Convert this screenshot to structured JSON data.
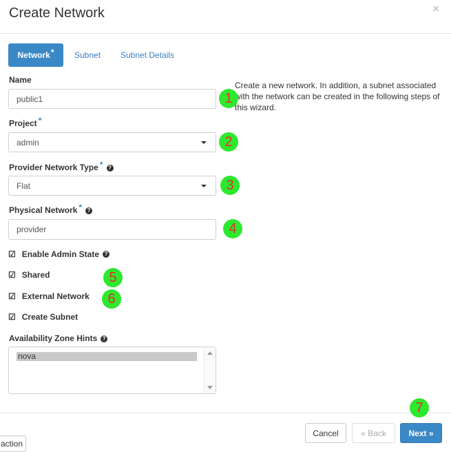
{
  "modal": {
    "title": "Create Network",
    "close_icon": "×"
  },
  "tabs": [
    {
      "label": "Network",
      "required_mark": "*",
      "active": true
    },
    {
      "label": "Subnet",
      "active": false
    },
    {
      "label": "Subnet Details",
      "active": false
    }
  ],
  "help_text": "Create a new network. In addition, a subnet associated with the network can be created in the following steps of this wizard.",
  "form": {
    "name": {
      "label": "Name",
      "value": "public1"
    },
    "project": {
      "label": "Project",
      "required_mark": "*",
      "value": "admin"
    },
    "provider_network_type": {
      "label": "Provider Network Type",
      "required_mark": "*",
      "help_icon": "?",
      "value": "Flat"
    },
    "physical_network": {
      "label": "Physical Network",
      "required_mark": "*",
      "help_icon": "?",
      "value": "provider"
    },
    "checkboxes": [
      {
        "label": "Enable Admin State",
        "checked": true,
        "help_icon": "?"
      },
      {
        "label": "Shared",
        "checked": true
      },
      {
        "label": "External Network",
        "checked": true
      },
      {
        "label": "Create Subnet",
        "checked": true
      }
    ],
    "availability_zone_hints": {
      "label": "Availability Zone Hints",
      "help_icon": "?",
      "options": [
        "nova"
      ]
    }
  },
  "annotations": [
    "1",
    "2",
    "3",
    "4",
    "5",
    "6",
    "7"
  ],
  "footer": {
    "cancel_label": "Cancel",
    "back_label": "« Back",
    "next_label": "Next »"
  },
  "background_tab": {
    "label": "action"
  },
  "colors": {
    "primary": "#3b88c7",
    "annotation_badge": "#2ee82e",
    "annotation_text": "#e0302a"
  },
  "icons": {
    "checkbox": "checkbox-checked-icon",
    "help": "question-circle-icon",
    "caret": "caret-down-icon",
    "close": "close-icon"
  }
}
